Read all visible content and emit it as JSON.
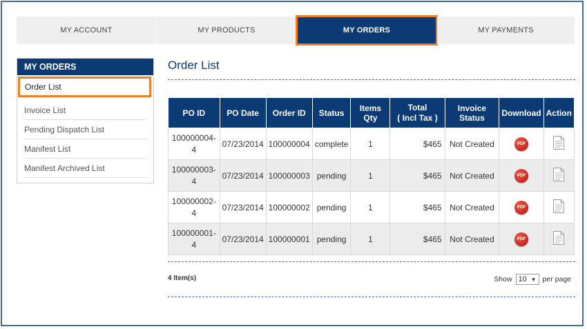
{
  "tabs": [
    "MY ACCOUNT",
    "MY PRODUCTS",
    "MY ORDERS",
    "MY PAYMENTS"
  ],
  "sidebar": {
    "title": "MY ORDERS",
    "items": [
      "Order List",
      "Invoice List",
      "Pending Dispatch List",
      "Manifest List",
      "Manifest Archived List"
    ]
  },
  "main": {
    "title": "Order List",
    "columns": [
      "PO ID",
      "PO Date",
      "Order ID",
      "Status",
      "Items Qty",
      "Total\n( Incl Tax )",
      "Invoice Status",
      "Download",
      "Action"
    ],
    "rows": [
      {
        "po_id_1": "100000004-",
        "po_id_2": "4",
        "po_date": "07/23/2014",
        "order_id": "100000004",
        "status": "complete",
        "qty": "1",
        "total": "$465",
        "invoice_status": "Not Created",
        "download_icon": "pdf-icon",
        "action_icon": "document-icon"
      },
      {
        "po_id_1": "100000003-",
        "po_id_2": "4",
        "po_date": "07/23/2014",
        "order_id": "100000003",
        "status": "pending",
        "qty": "1",
        "total": "$465",
        "invoice_status": "Not Created",
        "download_icon": "pdf-icon",
        "action_icon": "document-icon"
      },
      {
        "po_id_1": "100000002-",
        "po_id_2": "4",
        "po_date": "07/23/2014",
        "order_id": "100000002",
        "status": "pending",
        "qty": "1",
        "total": "$465",
        "invoice_status": "Not Created",
        "download_icon": "pdf-icon",
        "action_icon": "document-icon"
      },
      {
        "po_id_1": "100000001-",
        "po_id_2": "4",
        "po_date": "07/23/2014",
        "order_id": "100000001",
        "status": "pending",
        "qty": "1",
        "total": "$465",
        "invoice_status": "Not Created",
        "download_icon": "pdf-icon",
        "action_icon": "document-icon"
      }
    ],
    "pdf_label": "PDF",
    "items_count": "4 Item(s)",
    "pager": {
      "show_label": "Show",
      "per_page_value": "10",
      "per_page_label": "per page"
    }
  },
  "colors": {
    "primary": "#0b3a74",
    "highlight": "#f07f23",
    "border": "#3f6aa5",
    "pdf_red": "#c4150e"
  }
}
